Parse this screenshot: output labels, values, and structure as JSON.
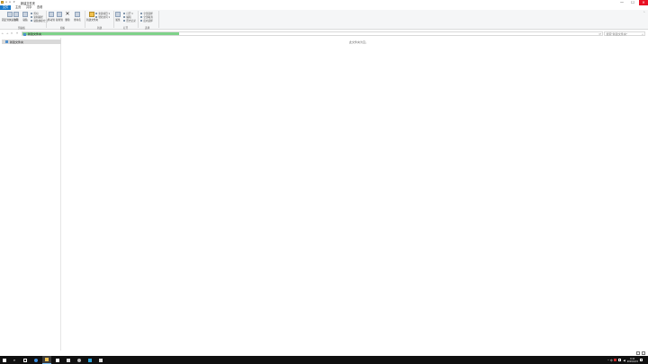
{
  "window": {
    "title": "新建文件夹",
    "controls": {
      "minimize": "—",
      "maximize": "☐",
      "close": "✕"
    }
  },
  "ribbon_tabs": [
    "文件",
    "主页",
    "共享",
    "查看"
  ],
  "ribbon": {
    "groups": [
      {
        "label": "剪贴板"
      },
      {
        "label": "组织"
      },
      {
        "label": "新建"
      },
      {
        "label": "打开"
      },
      {
        "label": "选择"
      }
    ],
    "big_buttons": [
      {
        "label": "固定到快速访问",
        "icon": "pin-icon"
      },
      {
        "label": "复制",
        "icon": "copy-icon"
      },
      {
        "label": "粘贴",
        "icon": "paste-icon"
      },
      {
        "label": "移动到",
        "icon": "move-icon"
      },
      {
        "label": "复制到",
        "icon": "copy-to-icon"
      },
      {
        "label": "删除",
        "icon": "delete-icon"
      },
      {
        "label": "重命名",
        "icon": "rename-icon"
      },
      {
        "label": "新建文件夹",
        "icon": "new-folder-icon"
      },
      {
        "label": "属性",
        "icon": "properties-icon"
      }
    ],
    "small_buttons": [
      {
        "label": "剪切",
        "icon": "cut-icon"
      },
      {
        "label": "复制路径",
        "icon": "copy-path-icon"
      },
      {
        "label": "粘贴快捷方式",
        "icon": "paste-shortcut-icon"
      },
      {
        "label": "新建项目 ▾",
        "icon": "new-item-icon"
      },
      {
        "label": "轻松访问 ▾",
        "icon": "easy-access-icon"
      },
      {
        "label": "打开 ▾",
        "icon": "open-icon"
      },
      {
        "label": "编辑",
        "icon": "edit-icon"
      },
      {
        "label": "历史记录",
        "icon": "history-icon"
      },
      {
        "label": "全部选择",
        "icon": "select-all-icon"
      },
      {
        "label": "全部取消",
        "icon": "select-none-icon"
      },
      {
        "label": "反向选择",
        "icon": "invert-selection-icon"
      }
    ]
  },
  "address": {
    "path": "新建文件夹",
    "progress": 0.27,
    "search_placeholder": "搜索\"新建文件夹\""
  },
  "nav": {
    "items": [
      {
        "label": "新建文件夹",
        "icon": "folder-icon"
      }
    ]
  },
  "content": {
    "empty_message": "此文件夹为空。"
  },
  "taskbar": {
    "time": "9:11",
    "date": "2019/1/15",
    "tray_text": "^ 中"
  },
  "colors": {
    "accent": "#1979ca",
    "progress": "#7fd28a",
    "close": "#e81123",
    "taskbar": "#101010"
  }
}
